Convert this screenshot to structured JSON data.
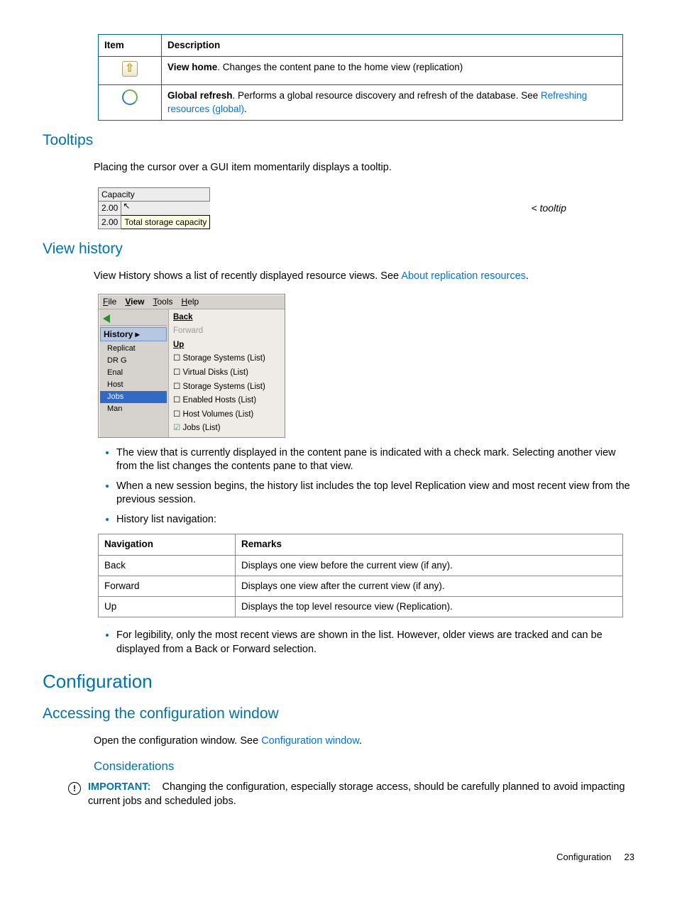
{
  "toolbar_table": {
    "head_item": "Item",
    "head_desc": "Description",
    "rows": [
      {
        "icon": "view-home-icon",
        "bold": "View home",
        "text": ". Changes the content pane to the home view (replication)"
      },
      {
        "icon": "global-refresh-icon",
        "bold": "Global refresh",
        "text": ". Performs a global resource discovery and refresh of the database. See ",
        "link": "Refreshing resources (global)",
        "after": "."
      }
    ]
  },
  "tooltips": {
    "heading": "Tooltips",
    "body": "Placing the cursor over a GUI item momentarily displays a tooltip.",
    "demo": {
      "header": "Capacity",
      "c1": "2.00",
      "c2": "2.00",
      "tip": "Total storage capacity"
    },
    "caption": "< tooltip"
  },
  "view_history": {
    "heading": "View history",
    "intro_pre": "View History shows a list of recently displayed resource views. See ",
    "intro_link": "About replication resources",
    "intro_post": ".",
    "shot": {
      "menubar": [
        "File",
        "View",
        "Tools",
        "Help"
      ],
      "history_label": "History  ▸",
      "left_nodes": [
        "Replicat",
        "DR G",
        "Enal",
        "Host",
        "Jobs",
        "Man"
      ],
      "right": {
        "back": "Back",
        "forward": "Forward",
        "up": "Up",
        "items": [
          "Storage Systems (List)",
          "Virtual Disks (List)",
          "Storage Systems (List)",
          "Enabled Hosts (List)",
          "Host Volumes (List)"
        ],
        "checked": "Jobs (List)"
      }
    },
    "bullets_a": [
      "The view that is currently displayed in the content pane is indicated with a check mark. Selecting another view from the list changes the contents pane to that view.",
      "When a new session begins, the history list includes the top level Replication view and most recent view from the previous session.",
      "History list navigation:"
    ],
    "nav_table": {
      "head_nav": "Navigation",
      "head_rem": "Remarks",
      "rows": [
        {
          "n": "Back",
          "r": "Displays one view before the current view (if any)."
        },
        {
          "n": "Forward",
          "r": "Displays one view after the current view (if any)."
        },
        {
          "n": "Up",
          "r": "Displays the top level resource view (Replication)."
        }
      ]
    },
    "bullets_b": [
      "For legibility, only the most recent views are shown in the list. However, older views are tracked and can be displayed from a Back or Forward selection."
    ]
  },
  "configuration": {
    "heading": "Configuration",
    "accessing": {
      "heading": "Accessing the configuration window",
      "body_pre": "Open the configuration window. See ",
      "body_link": "Configuration window",
      "body_post": "."
    },
    "considerations": {
      "heading": "Considerations",
      "important_label": "IMPORTANT:",
      "important_text": "Changing the configuration, especially storage access, should be carefully planned to avoid impacting current jobs and scheduled jobs."
    }
  },
  "footer": {
    "label": "Configuration",
    "page": "23"
  }
}
